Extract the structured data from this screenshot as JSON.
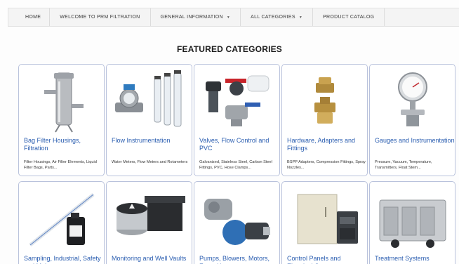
{
  "nav": {
    "items": [
      {
        "label": "HOME"
      },
      {
        "label": "WELCOME TO PRM FILTRATION"
      },
      {
        "label": "GENERAL INFORMATION",
        "dropdown": true
      },
      {
        "label": "ALL CATEGORIES",
        "dropdown": true
      },
      {
        "label": "PRODUCT CATALOG"
      }
    ],
    "caret": "▼"
  },
  "section_title": "FEATURED CATEGORIES",
  "categories": [
    {
      "name": "Bag Filter Housings, Filtration",
      "desc": "Filter Housings, Air Filter Elements, Liquid Filter Bags, Parts..."
    },
    {
      "name": "Flow Instrumentation",
      "desc": "Water Meters, Flow Meters and Rotameters"
    },
    {
      "name": "Valves, Flow Control and PVC",
      "desc": "Galvanized, Stainless Steel, Carbon Steel Fittings, PVC, Hose Clamps..."
    },
    {
      "name": "Hardware, Adapters and Fittings",
      "desc": "BSPP Adapters, Compression Fittings, Spray Nozzles..."
    },
    {
      "name": "Gauges and Instrumentation",
      "desc": "Pressure, Vacuum, Temperature, Transmitters, Float Stem..."
    },
    {
      "name": "Sampling, Industrial, Safety and Maintenance",
      "desc": ""
    },
    {
      "name": "Monitoring and Well Vaults",
      "desc": ""
    },
    {
      "name": "Pumps, Blowers, Motors, Fans, Heaters",
      "desc": ""
    },
    {
      "name": "Control Panels and Electrical Components",
      "desc": ""
    },
    {
      "name": "Treatment Systems",
      "desc": ""
    }
  ],
  "colors": {
    "link": "#2a5db0",
    "card_border": "#b9c2dc",
    "nav_bg": "#f4f4f4"
  }
}
